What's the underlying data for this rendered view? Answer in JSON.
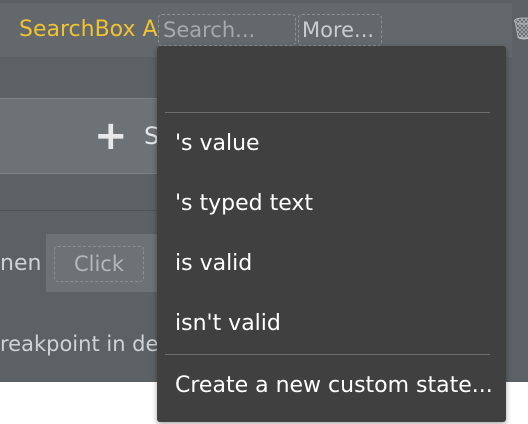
{
  "element": {
    "title": "SearchBox A",
    "search_placeholder": "Search...",
    "more_label": "More...",
    "trash_icon": "trash-icon"
  },
  "panel": {
    "add_icon": "plus-icon",
    "add_label": "S",
    "when_label": "nen",
    "click_label": "Click",
    "breakpoint_text": "reakpoint in de"
  },
  "dropdown": {
    "items": [
      "'s value",
      "'s typed text",
      "is valid",
      "isn't valid"
    ],
    "create_label": "Create a new custom state..."
  },
  "colors": {
    "title": "#f1c232",
    "menu_bg": "#404040",
    "panel_bg": "#5b6165"
  }
}
